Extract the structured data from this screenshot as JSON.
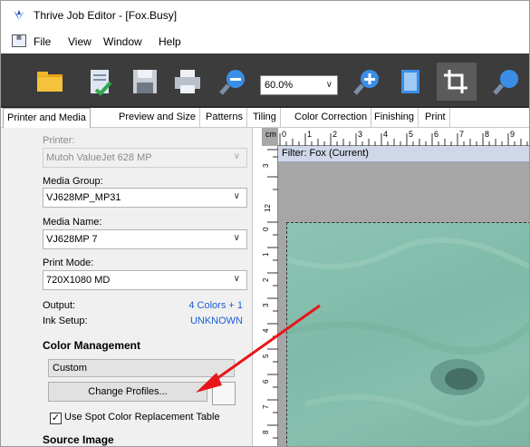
{
  "window": {
    "title": "Thrive Job Editor - [Fox.Busy]"
  },
  "menu": {
    "items": [
      "File",
      "View",
      "Window",
      "Help"
    ]
  },
  "toolbar": {
    "zoom_value": "60.0%"
  },
  "tabs": [
    {
      "label": "Printer and Media",
      "active": true
    },
    {
      "label": "Preview and Size",
      "active": false
    },
    {
      "label": "Patterns",
      "active": false
    },
    {
      "label": "Tiling",
      "active": false
    },
    {
      "label": "Color Correction",
      "active": false
    },
    {
      "label": "Finishing",
      "active": false
    },
    {
      "label": "Print",
      "active": false
    }
  ],
  "panel": {
    "printer_label": "Printer:",
    "printer_value": "Mutoh ValueJet 628 MP",
    "media_group_label": "Media Group:",
    "media_group_value": "VJ628MP_MP31",
    "media_name_label": "Media Name:",
    "media_name_value": "VJ628MP 7",
    "print_mode_label": "Print Mode:",
    "print_mode_value": "720X1080 MD",
    "output_label": "Output:",
    "output_value": "4 Colors + 1",
    "ink_setup_label": "Ink Setup:",
    "ink_setup_value": "UNKNOWN",
    "color_management_heading": "Color Management",
    "color_profile_value": "Custom",
    "change_profiles_label": "Change Profiles...",
    "spot_color_label": "Use Spot Color Replacement Table",
    "spot_color_checked": true,
    "source_image_heading": "Source Image"
  },
  "preview": {
    "unit": "cm",
    "filter_text": "Filter: Fox (Current)",
    "hruler_numbers": [
      "0",
      "1",
      "2",
      "3",
      "4",
      "5",
      "6",
      "7",
      "8",
      "9"
    ],
    "vruler_numbers": [
      "3",
      "12",
      "0",
      "1",
      "2",
      "3",
      "4",
      "5",
      "6",
      "7",
      "8"
    ]
  },
  "colors": {
    "toolbar_bg": "#3c3c3c",
    "link_blue": "#1a5ed8",
    "annotation_arrow": "#e8161b",
    "image_tint": "#86bfad"
  }
}
